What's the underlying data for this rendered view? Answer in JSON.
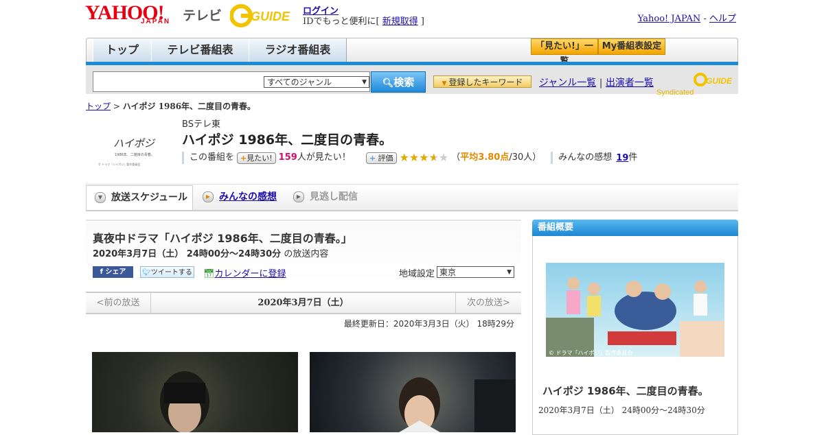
{
  "header": {
    "logo_yahoo": "YAHOO!",
    "logo_japan": "JAPAN",
    "logo_tv": "テレビ",
    "logo_gguide": "G GUIDE",
    "login": "ログイン",
    "login_sub_prefix": "IDでもっと便利に[ ",
    "register": "新規取得",
    "login_sub_suffix": " ]",
    "yahoo_japan_link": "Yahoo! JAPAN",
    "help_link": "ヘルプ",
    "separator": " - "
  },
  "nav": {
    "tabs": [
      "トップ",
      "テレビ番組表",
      "ラジオ番組表"
    ],
    "mitai_list": "「見たい!」一覧",
    "my_settings": "My番組表設定"
  },
  "search": {
    "genre": "すべてのジャンル",
    "button": "検索",
    "keyword_button": "登録したキーワード",
    "genre_list": "ジャンル一覧",
    "performer_list": "出演者一覧",
    "syndicated": "Syndicated"
  },
  "breadcrumb": {
    "home": "トップ",
    "current": "ハイポジ 1986年、二度目の青春。"
  },
  "program": {
    "channel": "BSテレ東",
    "title": "ハイポジ 1986年、二度目の青春。",
    "want_prefix": "この番組を",
    "want_button": "見たい!",
    "want_count": "159",
    "want_suffix": "人が見たい！",
    "rating_button": "評価",
    "rating_stars": 3.8,
    "rating_text_open": "（",
    "rating_avg": "平均3.80点",
    "rating_people": "/30人）",
    "impressions_label": "みんなの感想",
    "impressions_count": "19",
    "impressions_unit": "件"
  },
  "tabs": {
    "schedule": "放送スケジュール",
    "impressions": "みんなの感想",
    "vod": "見逃し配信"
  },
  "main": {
    "heading": "真夜中ドラマ「ハイポジ 1986年、二度目の青春。」",
    "datetime": "2020年3月7日（土） 24時00分～24時30分",
    "datetime_suffix": "の放送内容",
    "share_fb": "シェア",
    "share_tw": "ツイートする",
    "calendar": "カレンダーに登録",
    "region_label": "地域設定",
    "region_value": "東京",
    "prev": "<前の放送",
    "date": "2020年3月7日（土）",
    "next": "次の放送>",
    "updated": "最終更新日：2020年3月3日（火） 18時29分"
  },
  "sidebar": {
    "heading": "番組概要",
    "image_caption": "© ドラマ「ハイポジ」製作委員会",
    "title": "ハイポジ 1986年、二度目の青春。",
    "date": "2020年3月7日（土） 24時00分～24時30分"
  },
  "program_logo": {
    "text": "ハイポジ",
    "subtitle": "1986年、二度目の青春。",
    "copyright": "© ドラマ「ハイポジ」製作委員会"
  },
  "colors": {
    "accent_blue": "#1b8bd6",
    "yahoo_red": "#e60012",
    "star": "#e2a800",
    "pink": "#d0106a"
  }
}
